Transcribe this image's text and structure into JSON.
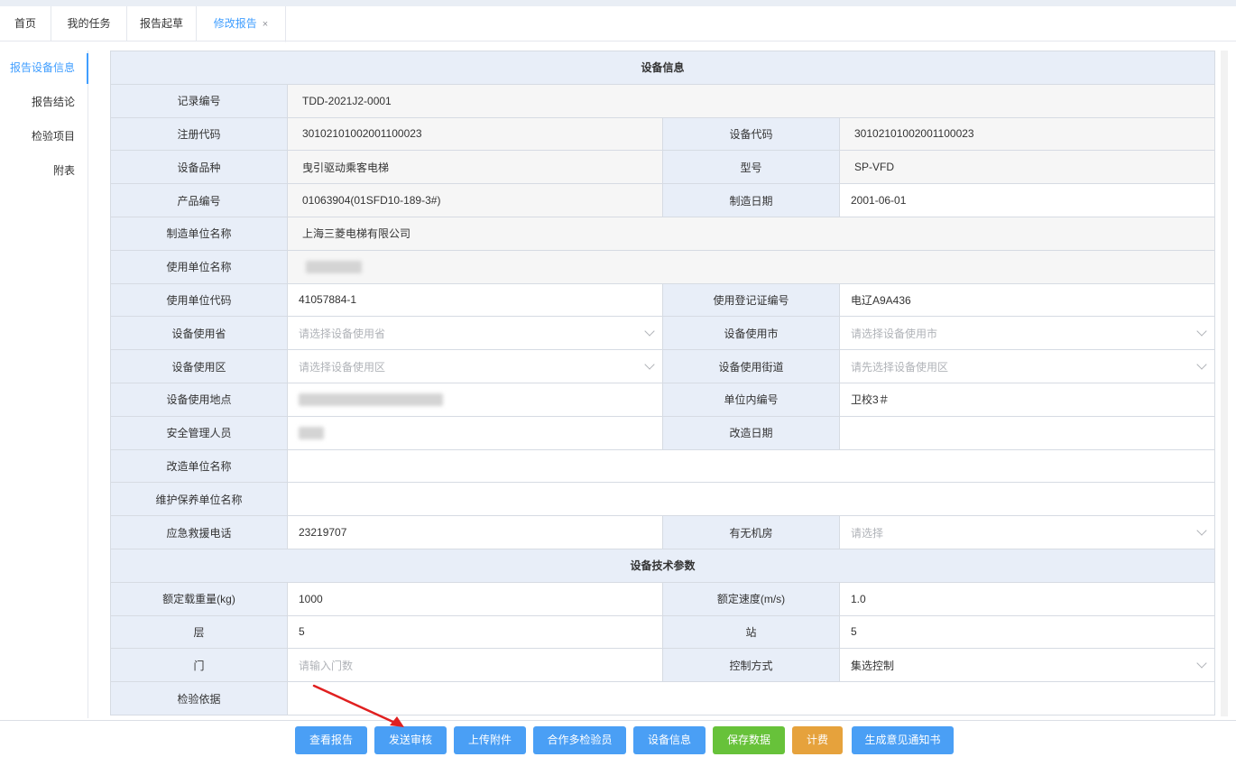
{
  "tabs": [
    {
      "label": "首页",
      "active": false
    },
    {
      "label": "我的任务",
      "active": false
    },
    {
      "label": "报告起草",
      "active": false
    },
    {
      "label": "修改报告",
      "active": true,
      "close": "×"
    }
  ],
  "sidebar": {
    "items": [
      {
        "label": "报告设备信息",
        "active": true
      },
      {
        "label": "报告结论",
        "active": false
      },
      {
        "label": "检验项目",
        "active": false
      },
      {
        "label": "附表",
        "active": false
      }
    ]
  },
  "section1": {
    "title": "设备信息",
    "record_no_label": "记录编号",
    "record_no": "TDD-2021J2-0001",
    "reg_code_label": "注册代码",
    "reg_code": "30102101002001100023",
    "dev_code_label": "设备代码",
    "dev_code": "30102101002001100023",
    "variety_label": "设备品种",
    "variety": "曳引驱动乘客电梯",
    "model_label": "型号",
    "model": "SP-VFD",
    "product_no_label": "产品编号",
    "product_no": "01063904(01SFD10-189-3#)",
    "mfg_date_label": "制造日期",
    "mfg_date": "2001-06-01",
    "maker_label": "制造单位名称",
    "maker": "上海三菱电梯有限公司",
    "user_unit_label": "使用单位名称",
    "user_code_label": "使用单位代码",
    "user_code": "41057884-1",
    "cert_no_label": "使用登记证编号",
    "cert_no": "电辽A9A436",
    "province_label": "设备使用省",
    "province_ph": "请选择设备使用省",
    "city_label": "设备使用市",
    "city_ph": "请选择设备使用市",
    "district_label": "设备使用区",
    "district_ph": "请选择设备使用区",
    "street_label": "设备使用街道",
    "street_ph": "请先选择设备使用区",
    "location_label": "设备使用地点",
    "inner_no_label": "单位内编号",
    "inner_no": "卫校3＃",
    "safety_mgr_label": "安全管理人员",
    "rebuild_date_label": "改造日期",
    "rebuild_date": "",
    "rebuild_unit_label": "改造单位名称",
    "rebuild_unit": "",
    "maint_unit_label": "维护保养单位名称",
    "maint_unit": "",
    "emergency_label": "应急救援电话",
    "emergency": "23219707",
    "machine_room_label": "有无机房",
    "machine_room_ph": "请选择"
  },
  "section2": {
    "title": "设备技术参数",
    "load_label": "额定载重量(kg)",
    "load": "1000",
    "speed_label": "额定速度(m/s)",
    "speed": "1.0",
    "floors_label": "层",
    "floors": "5",
    "stations_label": "站",
    "stations": "5",
    "doors_label": "门",
    "doors_ph": "请输入门数",
    "control_label": "控制方式",
    "control": "集选控制",
    "basis_label": "检验依据",
    "basis": ""
  },
  "buttons": [
    {
      "label": "查看报告",
      "color": "#4a9ff5"
    },
    {
      "label": "发送审核",
      "color": "#4a9ff5"
    },
    {
      "label": "上传附件",
      "color": "#4a9ff5"
    },
    {
      "label": "合作多检验员",
      "color": "#4a9ff5"
    },
    {
      "label": "设备信息",
      "color": "#4a9ff5"
    },
    {
      "label": "保存数据",
      "color": "#67c23a"
    },
    {
      "label": "计费",
      "color": "#e6a23c"
    },
    {
      "label": "生成意见通知书",
      "color": "#4a9ff5"
    }
  ],
  "colors": {
    "accent": "#409eff",
    "label_bg": "#e8eef8",
    "annotation_arrow": "#e02020"
  }
}
